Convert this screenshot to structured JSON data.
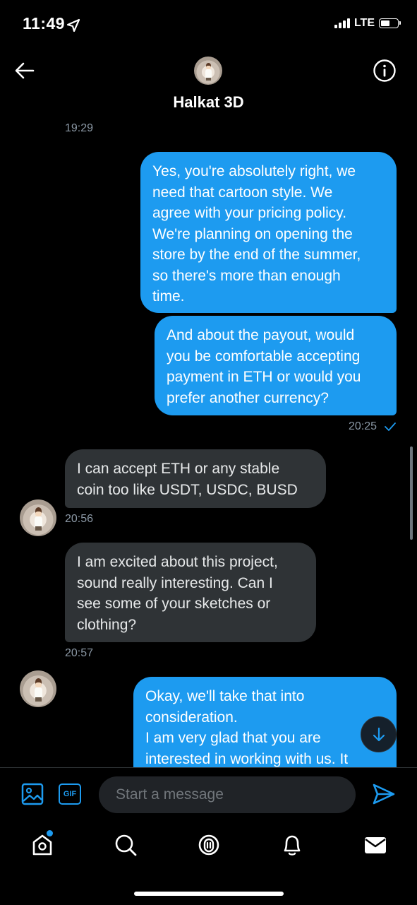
{
  "status": {
    "time": "11:49",
    "network": "LTE",
    "battery_level": 0.55
  },
  "header": {
    "title": "Halkat 3D",
    "icons": {
      "back": "back-arrow-icon",
      "info": "info-icon"
    }
  },
  "messages": [
    {
      "type": "timestamp",
      "text": "19:29"
    },
    {
      "type": "outgoing",
      "lines": [
        "Yes, you're absolutely right, we",
        "need that cartoon style. We",
        "agree with your pricing policy.",
        "We're planning on opening the",
        "store by the end of the summer,",
        "so there's more than enough",
        "time."
      ]
    },
    {
      "type": "outgoing",
      "lines": [
        "And about the payout, would",
        "you be comfortable accepting",
        "payment in ETH or would you",
        "prefer another currency?"
      ],
      "time": "20:25"
    },
    {
      "type": "incoming",
      "lines": [
        "I can accept ETH or any stable",
        "coin too like USDT, USDC, BUSD"
      ],
      "time": "20:56"
    },
    {
      "type": "incoming",
      "lines": [
        "I am excited about this project,",
        "sound really interesting. Can I",
        "see some of your sketches or",
        "clothing?"
      ],
      "time": "20:57"
    },
    {
      "type": "outgoing",
      "lines": [
        "Okay, we'll take that into",
        "consideration.",
        "I am very glad that you are",
        "interested in working with us. It"
      ]
    }
  ],
  "composer": {
    "placeholder": "Start a message",
    "gif_label": "GIF",
    "icons": {
      "image": "image-icon",
      "send": "send-icon"
    }
  },
  "nav": {
    "items": [
      {
        "name": "home",
        "icon": "home-icon",
        "has_notification_dot": true
      },
      {
        "name": "search",
        "icon": "search-icon"
      },
      {
        "name": "spaces",
        "icon": "spaces-icon"
      },
      {
        "name": "notifications",
        "icon": "bell-icon"
      },
      {
        "name": "messages",
        "icon": "mail-icon",
        "active": true
      }
    ]
  },
  "colors": {
    "accent": "#1d9bf0",
    "incoming_bubble": "#2f3336",
    "background": "#000000",
    "muted": "#8b98a5"
  }
}
